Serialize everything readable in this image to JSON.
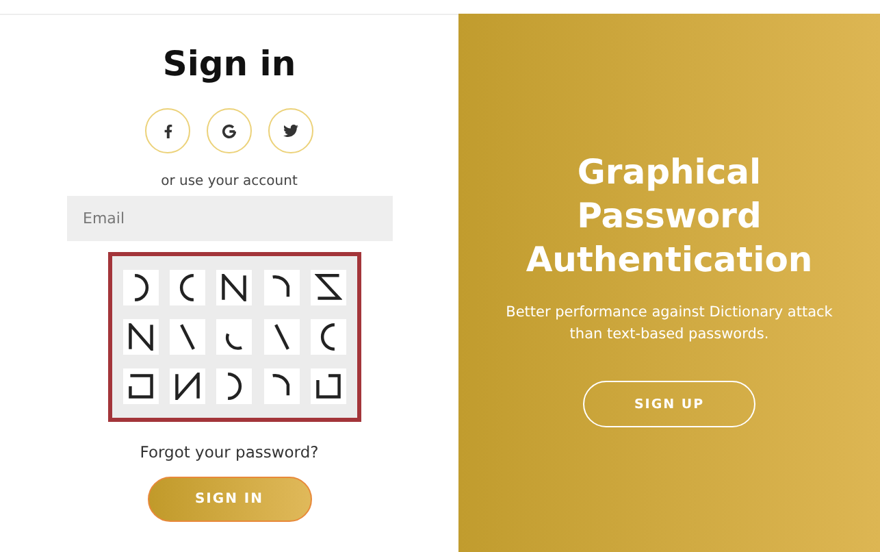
{
  "sign_in_panel": {
    "title": "Sign in",
    "social_buttons": [
      {
        "kind": "facebook"
      },
      {
        "kind": "google"
      },
      {
        "kind": "twitter"
      }
    ],
    "divider_text": "or use your account",
    "email_field": {
      "placeholder": "Email"
    },
    "forgot_link": "Forgot your password?",
    "submit_button": "SIGN IN"
  },
  "overlay_panel": {
    "title": "Graphical Password Authentication",
    "text": "Better performance against Dictionary attack than text-based passwords.",
    "button": "SIGN UP"
  }
}
